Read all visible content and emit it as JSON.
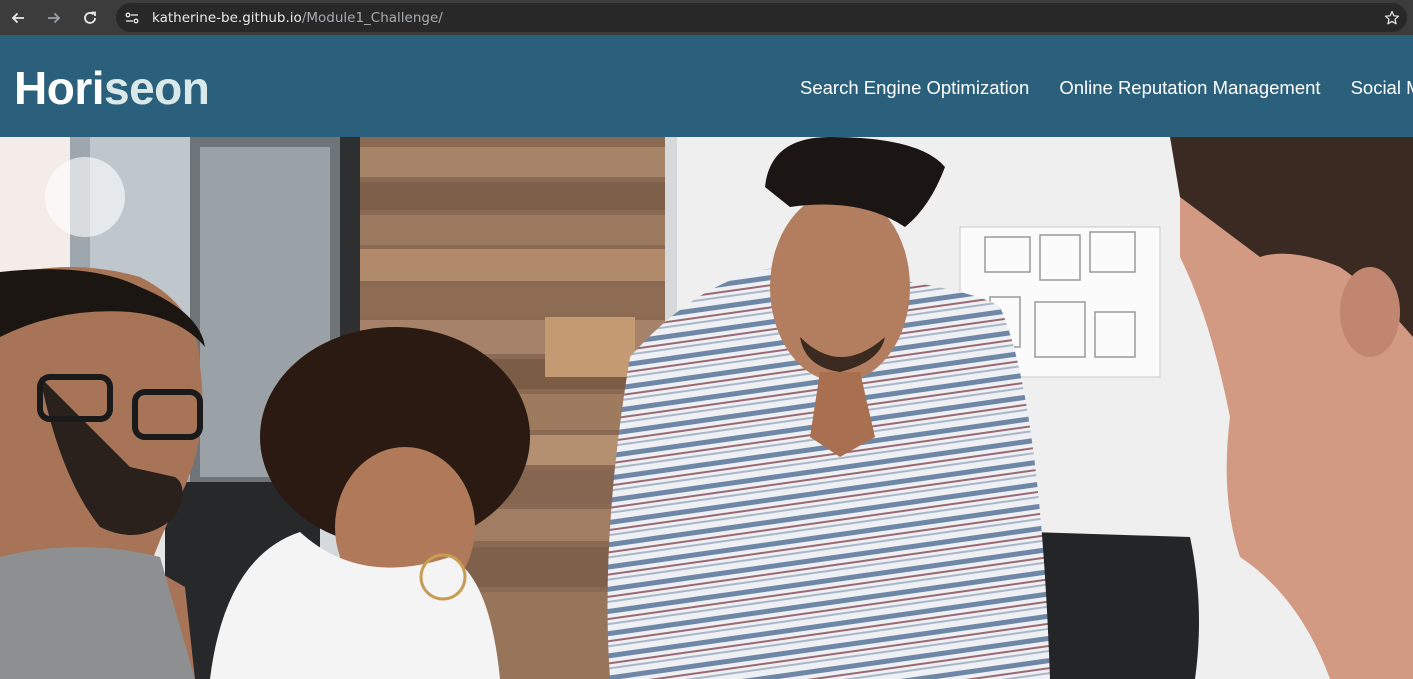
{
  "browser": {
    "url_domain": "katherine-be.github.io",
    "url_path": "/Module1_Challenge/"
  },
  "header": {
    "logo_main": "Hori",
    "logo_accent": "seon",
    "nav": [
      "Search Engine Optimization",
      "Online Reputation Management",
      "Social Media Marketing"
    ]
  },
  "hero": {
    "image_alt": "group of people working on a design"
  },
  "colors": {
    "header_bg": "#2a607c",
    "logo_accent": "#d9e9ea",
    "chrome_bg": "#3c3c3c"
  }
}
